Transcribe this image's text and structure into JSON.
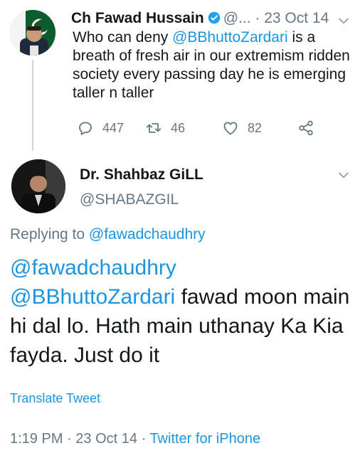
{
  "parent_tweet": {
    "author_name": "Ch Fawad Hussain",
    "handle_truncated": "@...",
    "separator": "·",
    "date": "23 Oct 14",
    "mention": "@BBhuttoZardari",
    "text_before_mention": "Who can deny ",
    "text_after_mention": " is a breath of fresh air in our extremism ridden society every passing day he is emerging taller n taller",
    "replies": "447",
    "retweets": "46",
    "likes": "82"
  },
  "main_tweet": {
    "author_name": "Dr. Shahbaz GiLL",
    "handle": "@SHABAZGIL",
    "replying_prefix": "Replying to ",
    "replying_to": "@fawadchaudhry",
    "mention1": "@fawadchaudhry",
    "mention2": "@BBhuttoZardari",
    "text": " fawad moon main hi dal lo.  Hath main uthanay Ka Kia fayda. Just do it",
    "translate_label": "Translate Tweet",
    "time": "1:19 PM",
    "date": "23 Oct 14",
    "meta_separator": "·",
    "source": "Twitter for iPhone"
  },
  "colors": {
    "link": "#1b95e0",
    "secondary_text": "#657786",
    "verified_badge": "#1da1f2"
  },
  "icons": [
    "reply-icon",
    "retweet-icon",
    "like-icon",
    "share-icon",
    "chevron-down-icon",
    "verified-badge-icon"
  ]
}
